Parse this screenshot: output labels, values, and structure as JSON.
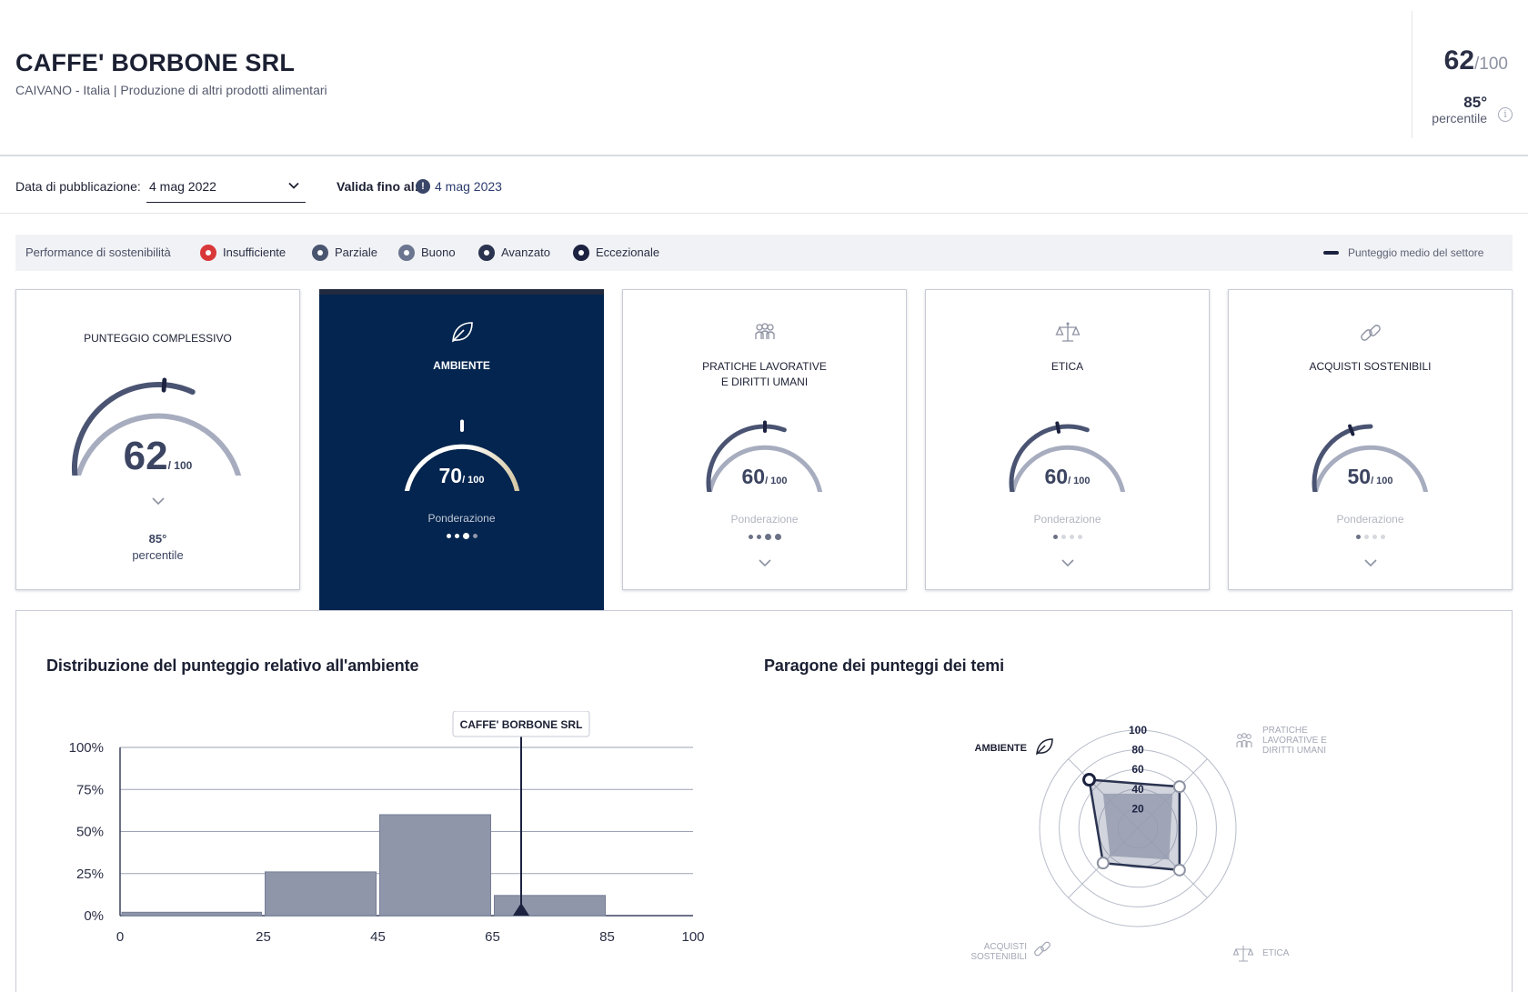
{
  "company": {
    "name": "CAFFE' BORBONE SRL",
    "subtitle": "CAIVANO -  Italia | Produzione di altri prodotti alimentari"
  },
  "overall": {
    "score": "62",
    "denominator": "/100",
    "percentile": "85°",
    "percentile_label": "percentile",
    "info_icon": "info-icon"
  },
  "date_bar": {
    "pub_label": "Data di pubblicazione:",
    "pub_value": "4 mag 2022",
    "valid_label": "Valida fino al:",
    "valid_value": "4 mag 2023",
    "warn_icon": "!"
  },
  "legend": {
    "title": "Performance di sostenibilità",
    "items": [
      {
        "label": "Insufficiente",
        "color": "#d9383a"
      },
      {
        "label": "Parziale",
        "color": "#4a5570"
      },
      {
        "label": "Buono",
        "color": "#6b7590"
      },
      {
        "label": "Avanzato",
        "color": "#2a3350"
      },
      {
        "label": "Eccezionale",
        "color": "#1c2240"
      }
    ],
    "avg_label": "Punteggio medio del settore"
  },
  "cards": [
    {
      "title": "PUNTEGGIO COMPLESSIVO",
      "score": "62",
      "den": "/ 100",
      "value": 62,
      "benchmark": 52,
      "percentile": "85°",
      "percentile_label": "percentile"
    },
    {
      "title": "AMBIENTE",
      "score": "70",
      "den": "/ 100",
      "value": 70,
      "benchmark": 50,
      "pond_label": "Ponderazione",
      "weight": 3,
      "icon": "leaf-icon"
    },
    {
      "title_l1": "PRATICHE LAVORATIVE",
      "title_l2": "E DIRITTI UMANI",
      "score": "60",
      "den": "/ 100",
      "value": 60,
      "benchmark": 50,
      "pond_label": "Ponderazione",
      "weight": 4,
      "icon": "people-icon"
    },
    {
      "title": "ETICA",
      "score": "60",
      "den": "/ 100",
      "value": 60,
      "benchmark": 45,
      "pond_label": "Ponderazione",
      "weight": 1,
      "icon": "scales-icon"
    },
    {
      "title": "ACQUISTI SOSTENIBILI",
      "score": "50",
      "den": "/ 100",
      "value": 50,
      "benchmark": 40,
      "pond_label": "Ponderazione",
      "weight": 1,
      "icon": "link-icon"
    }
  ],
  "distribution": {
    "title": "Distribuzione del punteggio relativo all'ambiente",
    "marker_label": "CAFFE' BORBONE SRL"
  },
  "radar": {
    "title": "Paragone dei punteggi dei temi",
    "labels": {
      "ambiente": "AMBIENTE",
      "pratiche": [
        "PRATICHE",
        "LAVORATIVE E",
        "DIRITTI UMANI"
      ],
      "etica": "ETICA",
      "acquisti": [
        "ACQUISTI",
        "SOSTENIBILI"
      ]
    },
    "ticks": [
      "100",
      "80",
      "60",
      "40",
      "20"
    ]
  },
  "chart_data": [
    {
      "type": "bar",
      "title": "Distribuzione del punteggio relativo all'ambiente",
      "bins": [
        [
          0,
          25
        ],
        [
          25,
          45
        ],
        [
          45,
          65
        ],
        [
          65,
          85
        ],
        [
          85,
          100
        ]
      ],
      "x_ticks": [
        "0",
        "25",
        "45",
        "65",
        "85",
        "100"
      ],
      "values": [
        2,
        26,
        60,
        12,
        0
      ],
      "y_ticks": [
        "0%",
        "25%",
        "50%",
        "75%",
        "100%"
      ],
      "ylim": [
        0,
        100
      ],
      "marker_x": 70,
      "marker_label": "CAFFE' BORBONE SRL"
    },
    {
      "type": "radar",
      "title": "Paragone dei punteggi dei temi",
      "axes": [
        "AMBIENTE",
        "PRATICHE LAVORATIVE E DIRITTI UMANI",
        "ETICA",
        "ACQUISTI SOSTENIBILI"
      ],
      "rlim": [
        0,
        100
      ],
      "ticks": [
        20,
        40,
        60,
        80,
        100
      ],
      "series": [
        {
          "values": [
            70,
            60,
            60,
            50
          ]
        }
      ],
      "benchmark": [
        50,
        50,
        45,
        40
      ]
    }
  ]
}
